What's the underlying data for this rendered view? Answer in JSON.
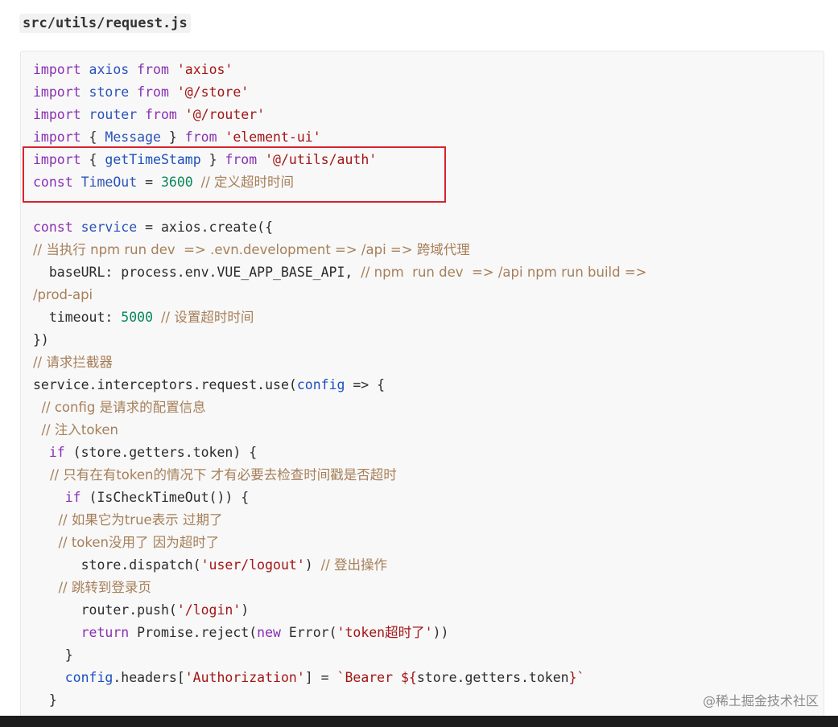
{
  "file_title": "src/utils/request.js",
  "code_lines": [
    [
      {
        "t": "import ",
        "c": "kw2"
      },
      {
        "t": "axios ",
        "c": "id"
      },
      {
        "t": "from ",
        "c": "kw2"
      },
      {
        "t": "'axios'",
        "c": "str"
      }
    ],
    [
      {
        "t": "import ",
        "c": "kw2"
      },
      {
        "t": "store ",
        "c": "id"
      },
      {
        "t": "from ",
        "c": "kw2"
      },
      {
        "t": "'@/store'",
        "c": "str"
      }
    ],
    [
      {
        "t": "import ",
        "c": "kw2"
      },
      {
        "t": "router ",
        "c": "id"
      },
      {
        "t": "from ",
        "c": "kw2"
      },
      {
        "t": "'@/router'",
        "c": "str"
      }
    ],
    [
      {
        "t": "import ",
        "c": "kw2"
      },
      {
        "t": "{ ",
        "c": ""
      },
      {
        "t": "Message ",
        "c": "id"
      },
      {
        "t": "} ",
        "c": ""
      },
      {
        "t": "from ",
        "c": "kw2"
      },
      {
        "t": "'element-ui'",
        "c": "str"
      }
    ],
    [
      {
        "t": "import ",
        "c": "kw2"
      },
      {
        "t": "{ ",
        "c": ""
      },
      {
        "t": "getTimeStamp ",
        "c": "fn"
      },
      {
        "t": "} ",
        "c": ""
      },
      {
        "t": "from ",
        "c": "kw2"
      },
      {
        "t": "'@/utils/auth'",
        "c": "str"
      }
    ],
    [
      {
        "t": "const ",
        "c": "kw2"
      },
      {
        "t": "TimeOut ",
        "c": "id"
      },
      {
        "t": "= ",
        "c": ""
      },
      {
        "t": "3600 ",
        "c": "num"
      },
      {
        "t": "// 定义超时时间",
        "c": "cm"
      }
    ],
    [],
    [
      {
        "t": "const ",
        "c": "kw2"
      },
      {
        "t": "service ",
        "c": "id"
      },
      {
        "t": "= axios.create({",
        "c": ""
      }
    ],
    [
      {
        "t": "// 当执行 npm run dev  => .evn.development => /api => 跨域代理",
        "c": "cm"
      }
    ],
    [
      {
        "t": "  baseURL: process.env.VUE_APP_BASE_API, ",
        "c": ""
      },
      {
        "t": "// npm  run dev  => /api npm run build =>",
        "c": "cm"
      }
    ],
    [
      {
        "t": "/prod-api",
        "c": "cm"
      }
    ],
    [
      {
        "t": "  timeout: ",
        "c": ""
      },
      {
        "t": "5000 ",
        "c": "num"
      },
      {
        "t": "// 设置超时时间",
        "c": "cm"
      }
    ],
    [
      {
        "t": "})",
        "c": ""
      }
    ],
    [
      {
        "t": "// 请求拦截器",
        "c": "cm"
      }
    ],
    [
      {
        "t": "service.interceptors.request.use(",
        "c": ""
      },
      {
        "t": "config ",
        "c": "fn"
      },
      {
        "t": "=> {",
        "c": ""
      }
    ],
    [
      {
        "t": "  // config 是请求的配置信息",
        "c": "cm"
      }
    ],
    [
      {
        "t": "  // 注入token",
        "c": "cm"
      }
    ],
    [
      {
        "t": "  if ",
        "c": "kw2"
      },
      {
        "t": "(store.getters.token) {",
        "c": ""
      }
    ],
    [
      {
        "t": "    // 只有在有token的情况下 才有必要去检查时间戳是否超时",
        "c": "cm"
      }
    ],
    [
      {
        "t": "    if ",
        "c": "kw2"
      },
      {
        "t": "(IsCheckTimeOut()) {",
        "c": ""
      }
    ],
    [
      {
        "t": "      // 如果它为true表示 过期了",
        "c": "cm"
      }
    ],
    [
      {
        "t": "      // token没用了 因为超时了",
        "c": "cm"
      }
    ],
    [
      {
        "t": "      store.dispatch(",
        "c": ""
      },
      {
        "t": "'user/logout'",
        "c": "str"
      },
      {
        "t": ") ",
        "c": ""
      },
      {
        "t": "// 登出操作",
        "c": "cm"
      }
    ],
    [
      {
        "t": "      // 跳转到登录页",
        "c": "cm"
      }
    ],
    [
      {
        "t": "      router.push(",
        "c": ""
      },
      {
        "t": "'/login'",
        "c": "str"
      },
      {
        "t": ")",
        "c": ""
      }
    ],
    [
      {
        "t": "      return ",
        "c": "kw2"
      },
      {
        "t": "Promise.reject(",
        "c": ""
      },
      {
        "t": "new ",
        "c": "kw2"
      },
      {
        "t": "Error(",
        "c": ""
      },
      {
        "t": "'token超时了'",
        "c": "str"
      },
      {
        "t": "))",
        "c": ""
      }
    ],
    [
      {
        "t": "    }",
        "c": ""
      }
    ],
    [
      {
        "t": "    config",
        "c": "fn"
      },
      {
        "t": ".headers[",
        "c": ""
      },
      {
        "t": "'Authorization'",
        "c": "str"
      },
      {
        "t": "] = ",
        "c": ""
      },
      {
        "t": "`Bearer ${",
        "c": "str"
      },
      {
        "t": "store.getters.token",
        "c": ""
      },
      {
        "t": "}`",
        "c": "str"
      }
    ],
    [
      {
        "t": "  }",
        "c": ""
      }
    ]
  ],
  "watermark": "@稀土掘金技术社区",
  "colors": {
    "highlight_border": "#d9232e",
    "keyword": "#8a2fb3",
    "string": "#a31515",
    "number": "#098658",
    "comment": "#a67f59",
    "identifier": "#2b52b8"
  }
}
